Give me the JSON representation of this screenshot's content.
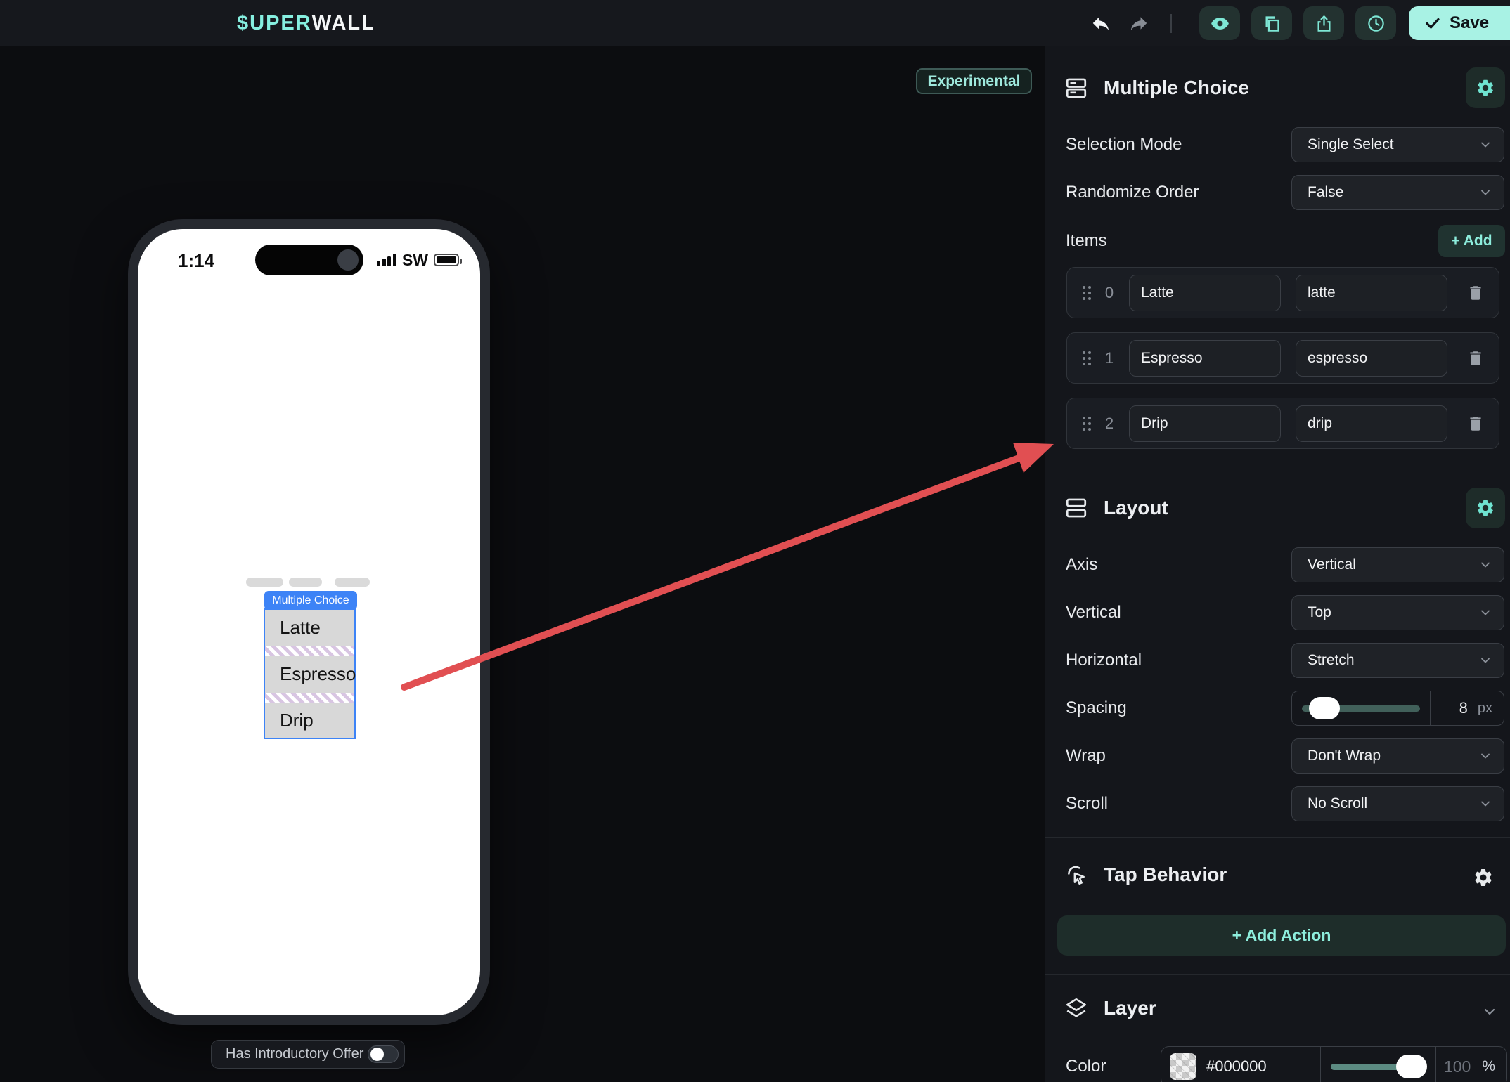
{
  "topbar": {
    "logo_accent": "$UPER",
    "logo_rest": "WALL",
    "save": "Save"
  },
  "canvas": {
    "badge": "Experimental",
    "phone": {
      "time": "1:14",
      "carrier": "SW",
      "component_label": "Multiple Choice",
      "options": [
        "Latte",
        "Espresso",
        "Drip"
      ]
    },
    "intro_toggle": "Has Introductory Offer"
  },
  "sidebar": {
    "component": {
      "title": "Multiple Choice",
      "selection_mode_label": "Selection Mode",
      "selection_mode_value": "Single Select",
      "randomize_label": "Randomize Order",
      "randomize_value": "False",
      "items_label": "Items",
      "add_button": "+ Add",
      "items": [
        {
          "index": "0",
          "label": "Latte",
          "value": "latte"
        },
        {
          "index": "1",
          "label": "Espresso",
          "value": "espresso"
        },
        {
          "index": "2",
          "label": "Drip",
          "value": "drip"
        }
      ]
    },
    "layout": {
      "title": "Layout",
      "axis_label": "Axis",
      "axis_value": "Vertical",
      "vertical_label": "Vertical",
      "vertical_value": "Top",
      "horizontal_label": "Horizontal",
      "horizontal_value": "Stretch",
      "spacing_label": "Spacing",
      "spacing_value": "8",
      "spacing_unit": "px",
      "wrap_label": "Wrap",
      "wrap_value": "Don't Wrap",
      "scroll_label": "Scroll",
      "scroll_value": "No Scroll"
    },
    "tap_behavior": {
      "title": "Tap Behavior",
      "add_action": "+ Add Action"
    },
    "layer": {
      "title": "Layer",
      "color_label": "Color",
      "color_hex": "#000000",
      "opacity": "100",
      "opacity_unit": "%"
    }
  },
  "colors": {
    "accent_mint": "#8deddc",
    "accent_blue": "#3d83f6",
    "arrow_red": "#e14f52",
    "save_bg": "#a8f2e4"
  }
}
